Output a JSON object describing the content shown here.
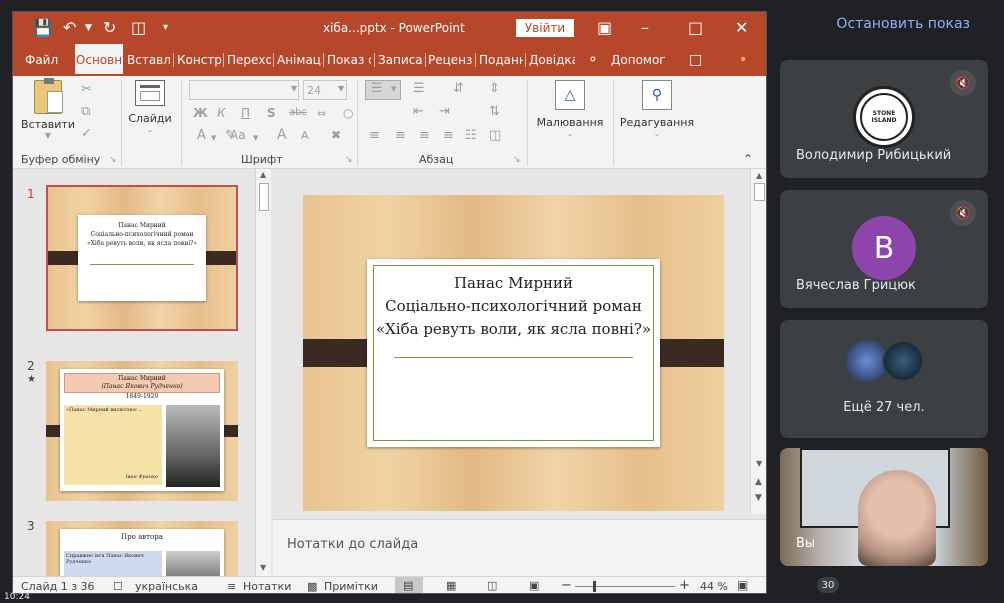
{
  "meet": {
    "stop_label": "Остановить показ",
    "more_label": "Ещё 27 чел.",
    "participant1": "Володимир Рибицький",
    "participant2": "Вячеслав Грицюк",
    "avatar2_letter": "B",
    "self_label": "Вы",
    "count": "30",
    "stone_text": "STONE ISLAND"
  },
  "ppt": {
    "filename": "хіба...pptx - PowerPoint",
    "signin": "Увійти",
    "tabs": [
      "Файл",
      "Основн",
      "Вставле",
      "Констру",
      "Перехо",
      "Анімац",
      "Показ с",
      "Записа",
      "Рецензу",
      "Поданн",
      "Довідка"
    ],
    "help_search": "Допомог",
    "ribbon": {
      "paste": "Вставити",
      "slides": "Слайди",
      "font_size": "24",
      "drawing": "Малювання",
      "editing": "Редагування",
      "g_clipboard": "Буфер обміну",
      "g_font": "Шрифт",
      "g_paragraph": "Абзац",
      "bold": "Ж",
      "italic": "К",
      "underline": "П",
      "strike": "S",
      "shadow": "abc",
      "font_grow": "A",
      "font_shrink": "A",
      "case": "Aa"
    },
    "slides": [
      {
        "num": "1",
        "title": "Панас Мирний",
        "line2": "Соціально-психологічний роман",
        "line3": "«Хіба ревуть воли, як ясла повні?»"
      },
      {
        "num": "2",
        "star": "★",
        "title": "Панас Мирний",
        "sub": "(Панас Якович Рудченко)",
        "years": "1849-1920",
        "quote": "«Панас Мирний висвітлює ...",
        "author": "Іван Франко"
      },
      {
        "num": "3",
        "title": "Про автора",
        "text": "Справжнє ім'я Панас Якович Рудченко"
      }
    ],
    "main_slide": {
      "line1": "Панас Мирний",
      "line2": "Соціально-психологічний роман",
      "line3": "«Хіба ревуть воли, як ясла повні?»"
    },
    "notes_placeholder": "Нотатки до слайда",
    "status": {
      "slide_info": "Слайд 1 з 36",
      "language": "українська",
      "notes": "Нотатки",
      "comments": "Примітки",
      "zoom": "44 %",
      "zoom_minus": "−",
      "zoom_plus": "+"
    }
  },
  "taskbar": {
    "time": "10:24"
  }
}
